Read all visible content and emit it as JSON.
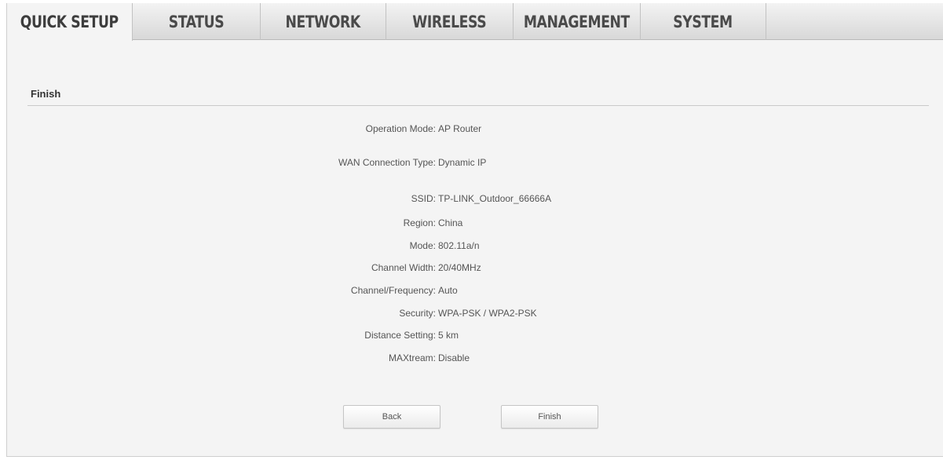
{
  "tabs": [
    {
      "label": "QUICK SETUP",
      "active": true
    },
    {
      "label": "STATUS",
      "active": false
    },
    {
      "label": "NETWORK",
      "active": false
    },
    {
      "label": "WIRELESS",
      "active": false
    },
    {
      "label": "MANAGEMENT",
      "active": false
    },
    {
      "label": "SYSTEM",
      "active": false
    }
  ],
  "section": {
    "title": "Finish"
  },
  "summary": {
    "operation_mode": {
      "label": "Operation Mode:",
      "value": "AP Router"
    },
    "wan_type": {
      "label": "WAN Connection Type:",
      "value": "Dynamic IP"
    },
    "ssid": {
      "label": "SSID:",
      "value": "TP-LINK_Outdoor_66666A"
    },
    "region": {
      "label": "Region:",
      "value": "China"
    },
    "mode": {
      "label": "Mode:",
      "value": "802.11a/n"
    },
    "channel_width": {
      "label": "Channel Width:",
      "value": "20/40MHz"
    },
    "channel_frequency": {
      "label": "Channel/Frequency:",
      "value": "Auto"
    },
    "security": {
      "label": "Security:",
      "value": "WPA-PSK / WPA2-PSK"
    },
    "distance_setting": {
      "label": "Distance Setting:",
      "value": "5 km"
    },
    "maxtream": {
      "label": "MAXtream:",
      "value": "Disable"
    }
  },
  "buttons": {
    "back": "Back",
    "finish": "Finish"
  },
  "colors": {
    "panel_bg": "#f4f4f4",
    "tab_text": "#4a4a4a",
    "body_text": "#555555"
  }
}
